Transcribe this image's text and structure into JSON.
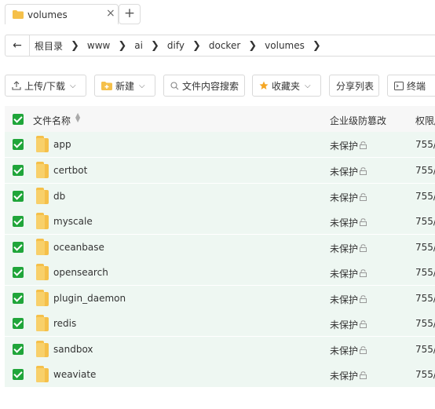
{
  "tab": {
    "title": "volumes",
    "close": "×",
    "new": "+"
  },
  "address": {
    "back": "←",
    "crumbs": [
      "根目录",
      "www",
      "ai",
      "dify",
      "docker",
      "volumes"
    ],
    "separator": "❯"
  },
  "toolbar": {
    "upload": "上传/下载",
    "new": "新建",
    "search": "文件内容搜索",
    "favorites": "收藏夹",
    "share": "分享列表",
    "terminal": "终端"
  },
  "table": {
    "headers": {
      "name": "文件名称",
      "protection": "企业级防篡改",
      "permission": "权限/"
    },
    "rows": [
      {
        "name": "app",
        "protection": "未保护",
        "permission": "755/"
      },
      {
        "name": "certbot",
        "protection": "未保护",
        "permission": "755/"
      },
      {
        "name": "db",
        "protection": "未保护",
        "permission": "755/"
      },
      {
        "name": "myscale",
        "protection": "未保护",
        "permission": "755/"
      },
      {
        "name": "oceanbase",
        "protection": "未保护",
        "permission": "755/"
      },
      {
        "name": "opensearch",
        "protection": "未保护",
        "permission": "755/"
      },
      {
        "name": "plugin_daemon",
        "protection": "未保护",
        "permission": "755/"
      },
      {
        "name": "redis",
        "protection": "未保护",
        "permission": "755/"
      },
      {
        "name": "sandbox",
        "protection": "未保护",
        "permission": "755/"
      },
      {
        "name": "weaviate",
        "protection": "未保护",
        "permission": "755/"
      }
    ]
  },
  "colors": {
    "accent": "#20a53a",
    "folder": "#f5c04a",
    "row_bg": "#eef7f2"
  },
  "icons": {
    "folder": "folder-icon",
    "lock": "lock-icon",
    "search": "search-icon",
    "star": "star-icon",
    "upload": "upload-icon",
    "terminal": "terminal-icon"
  }
}
